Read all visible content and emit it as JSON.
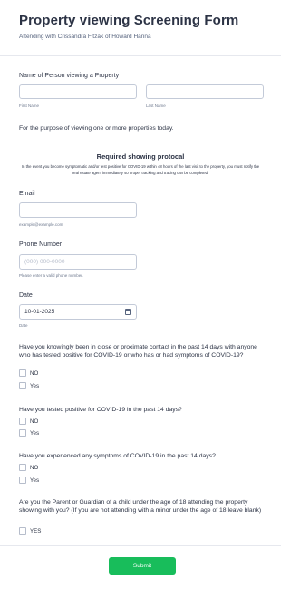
{
  "header": {
    "title": "Property viewing Screening Form",
    "subtitle": "Attending with Crissandra Fitzak of Howard Hanna"
  },
  "name_section": {
    "label": "Name of Person viewing a Property",
    "first_sublabel": "First Name",
    "last_sublabel": "Last Name",
    "first_value": "",
    "last_value": ""
  },
  "purpose_text": "For the purpose of viewing one or more properties today.",
  "protocol": {
    "title": "Required showing protocal",
    "text": "In the event you become symptomatic and/or test positive for COVID-19 within 48 hours of the last visit to the property, you must notify the real estate agent immediately so proper tracking and tracing can be completed."
  },
  "email": {
    "label": "Email",
    "value": "",
    "sublabel": "example@example.com"
  },
  "phone": {
    "label": "Phone Number",
    "placeholder": "(000) 000-0000",
    "sublabel": "Please enter a valid phone number."
  },
  "date": {
    "label": "Date",
    "value": "10-01-2025",
    "sublabel": "Date"
  },
  "questions": [
    {
      "text": "Have you knowingly been in close or proximate contact in the past 14 days with anyone who has tested positive for COVID-19 or who has or had symptoms of COVID-19?",
      "options": [
        "NO",
        "Yes"
      ]
    },
    {
      "text": "Have you tested positive for COVID-19 in the past 14 days?",
      "options": [
        "NO",
        "Yes"
      ]
    },
    {
      "text": "Have you experienced any symptoms of COVID-19 in the past 14 days?",
      "options": [
        "NO",
        "Yes"
      ]
    },
    {
      "text": "Are you the Parent or Guardian of a child under the age of 18 attending the property showing with you? (If you are not attending with a minor under the age of 18 leave blank)",
      "options": [
        "YES"
      ]
    }
  ],
  "submit_label": "Submit",
  "colors": {
    "accent": "#18bd5b",
    "text": "#2c3345",
    "border": "#c3cad8"
  }
}
